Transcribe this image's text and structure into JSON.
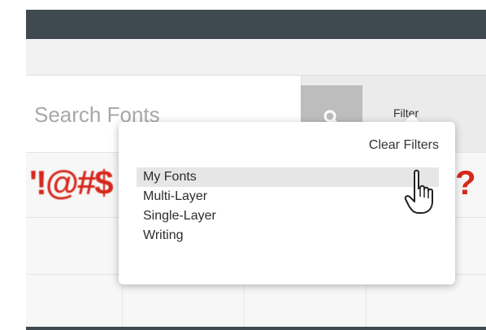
{
  "search": {
    "placeholder": "Search Fonts",
    "button_icon": "search-icon"
  },
  "filter": {
    "label": "Filter",
    "clear_label": "Clear Filters",
    "options": [
      {
        "label": "My Fonts",
        "highlighted": true
      },
      {
        "label": "Multi-Layer",
        "highlighted": false
      },
      {
        "label": "Single-Layer",
        "highlighted": false
      },
      {
        "label": "Writing",
        "highlighted": false
      }
    ]
  },
  "preview": {
    "left_text": "'!@#$",
    "right_text": "?"
  },
  "colors": {
    "header": "#3f4a50",
    "search_button": "#bdbdbd",
    "preview_text": "#d6281c",
    "highlight": "#e6e6e6"
  }
}
